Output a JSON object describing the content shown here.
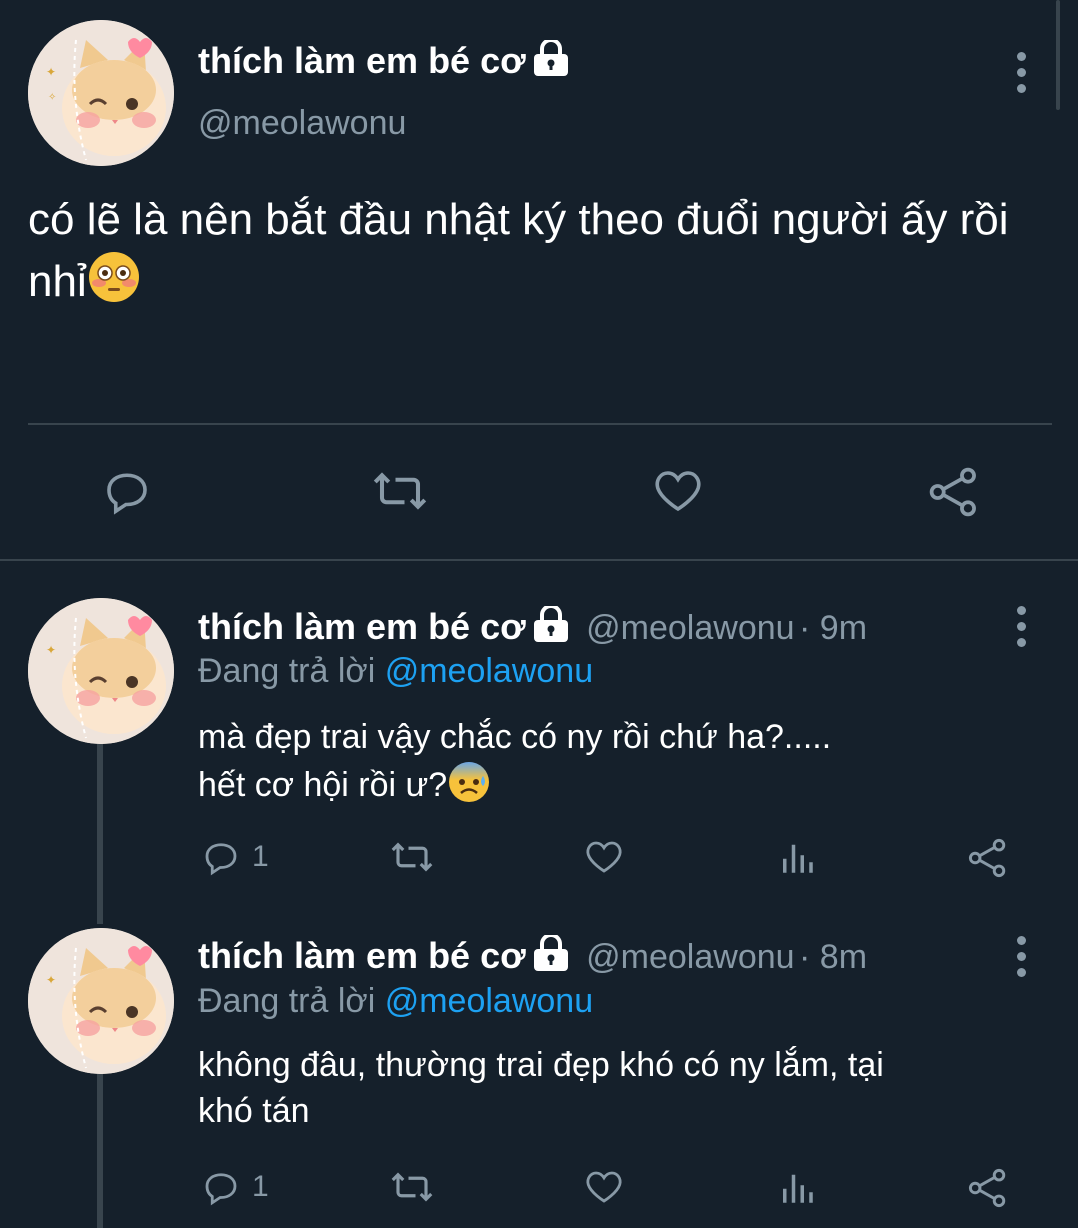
{
  "main_tweet": {
    "display_name": "thích làm em bé cơ",
    "handle": "@meolawonu",
    "text": "có lẽ là nên bắt đầu nhật ký theo đuổi người ấy rồi nhỉ",
    "emoji": "flushed-face"
  },
  "replies": [
    {
      "display_name": "thích làm em bé cơ",
      "handle": "@meolawonu",
      "time": "· 9m",
      "replying_prefix": "Đang trả lời",
      "replying_to": "@meolawonu",
      "text_line1": "mà đẹp trai vậy chắc có ny rồi chứ ha?.....",
      "text_line2": "hết cơ hội rồi ư?",
      "emoji": "anxious-face-with-sweat",
      "reply_count": "1"
    },
    {
      "display_name": "thích làm em bé cơ",
      "handle": "@meolawonu",
      "time": "· 8m",
      "replying_prefix": "Đang trả lời",
      "replying_to": "@meolawonu",
      "text_line1": "không đâu, thường trai đẹp khó có ny lắm, tại",
      "text_line2": "khó tán",
      "reply_count": "1"
    }
  ],
  "colors": {
    "background": "#15202b",
    "secondary_text": "#8899a6",
    "link": "#1da1f2",
    "divider": "#38444d"
  }
}
